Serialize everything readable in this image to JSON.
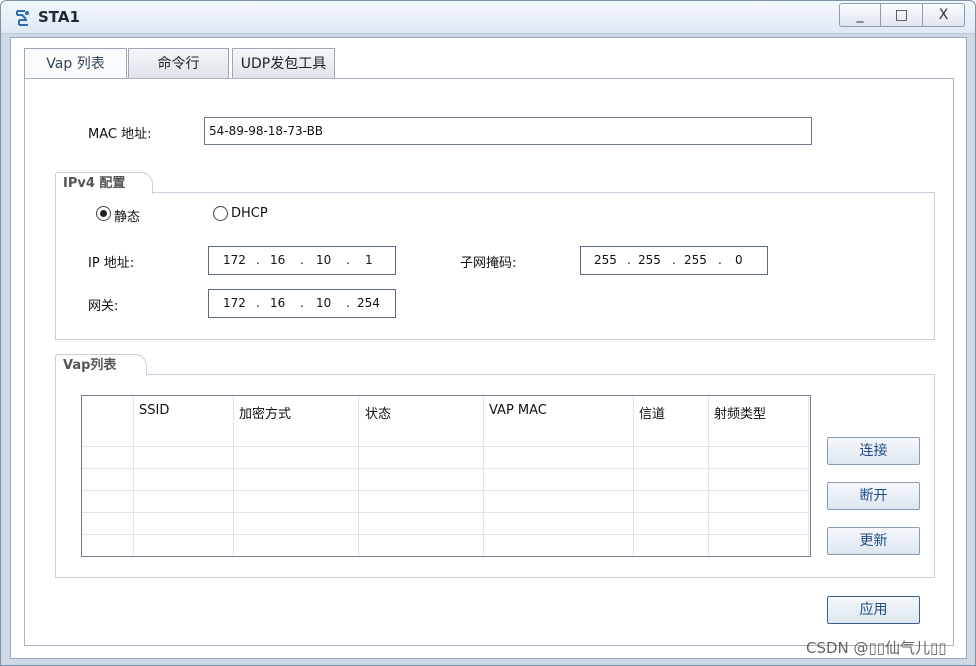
{
  "window": {
    "title": "STA1",
    "min_glyph": "_",
    "max_glyph": "□",
    "close_glyph": "X"
  },
  "tabs": [
    {
      "label": "Vap 列表"
    },
    {
      "label": "命令行"
    },
    {
      "label": "UDP发包工具"
    }
  ],
  "mac": {
    "label": "MAC 地址:",
    "value": "54-89-98-18-73-BB"
  },
  "ipv4": {
    "group_title": "IPv4 配置",
    "static_label": "静态",
    "dhcp_label": "DHCP",
    "selected": "static",
    "ip_label": "IP 地址:",
    "ip": [
      "172",
      "16",
      "10",
      "1"
    ],
    "mask_label": "子网掩码:",
    "mask": [
      "255",
      "255",
      "255",
      "0"
    ],
    "gateway_label": "网关:",
    "gateway": [
      "172",
      "16",
      "10",
      "254"
    ]
  },
  "vap": {
    "group_title": "Vap列表",
    "columns": [
      "SSID",
      "加密方式",
      "状态",
      "VAP MAC",
      "信道",
      "射频类型"
    ],
    "rows": []
  },
  "buttons": {
    "connect": "连接",
    "disconnect": "断开",
    "refresh": "更新",
    "apply": "应用"
  },
  "watermark": "CSDN @▯▯仙气儿▯▯"
}
